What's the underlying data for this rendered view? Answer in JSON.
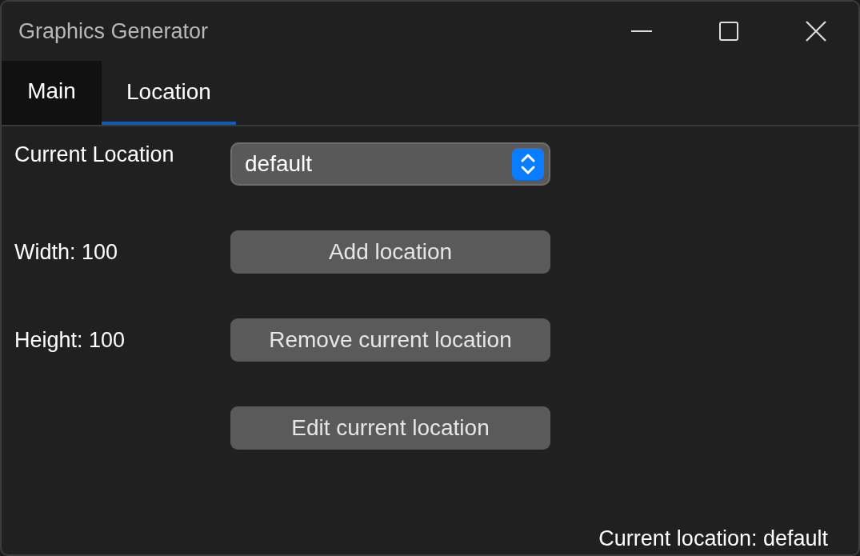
{
  "window": {
    "title": "Graphics Generator"
  },
  "tabs": [
    {
      "label": "Main",
      "selected": false
    },
    {
      "label": "Location",
      "selected": true
    }
  ],
  "form": [
    {
      "label": "Current Location",
      "kind": "select",
      "value": "default"
    },
    {
      "label": "Width: 100",
      "kind": "button",
      "value": "Add location"
    },
    {
      "label": "Height: 100",
      "kind": "button",
      "value": "Remove current location"
    },
    {
      "kind": "button",
      "value": "Edit current location"
    }
  ],
  "status_bar": {
    "text": "Current location: default"
  }
}
